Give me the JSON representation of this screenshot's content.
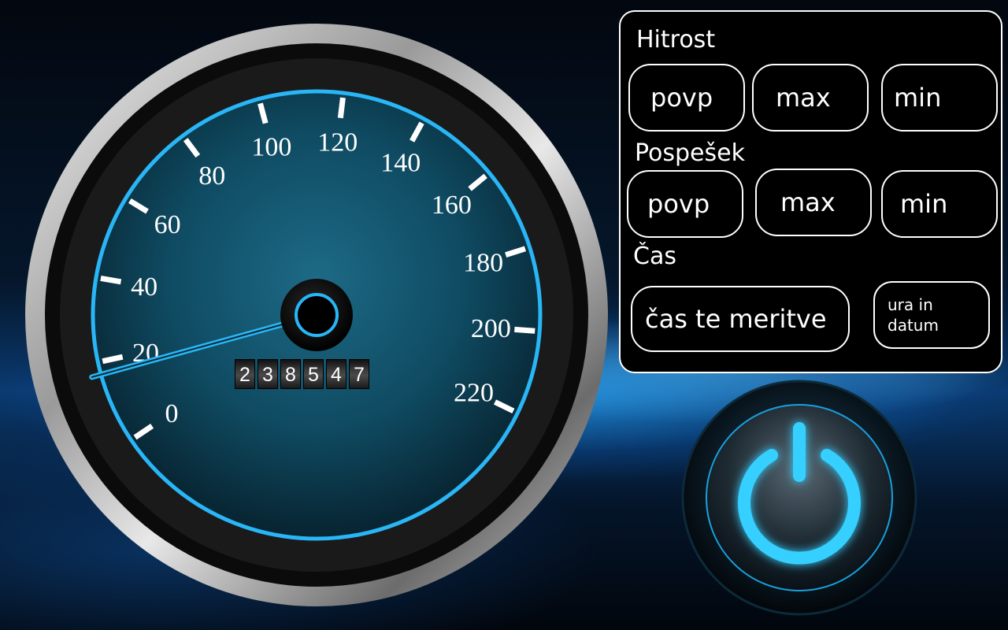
{
  "colors": {
    "accent": "#29b6f6",
    "accent_glow": "#35d0ff",
    "dial_face": "#0f4b62",
    "panel_bg": "#000000",
    "text": "#ffffff"
  },
  "speedometer": {
    "min_value": 0,
    "max_value": 220,
    "needle_value": 17,
    "tick_labels": [
      "0",
      "20",
      "40",
      "60",
      "80",
      "100",
      "120",
      "140",
      "160",
      "180",
      "200",
      "220"
    ],
    "odometer_digits": [
      "2",
      "3",
      "8",
      "5",
      "4",
      "7"
    ]
  },
  "panel": {
    "speed": {
      "label": "Hitrost",
      "avg_label": "povp",
      "max_label": "max",
      "min_label": "min"
    },
    "acceleration": {
      "label": "Pospešek",
      "avg_label": "povp",
      "max_label": "max",
      "min_label": "min"
    },
    "time": {
      "label": "Čas",
      "measurement_time_label": "čas te meritve",
      "clock_date_line1": "ura in",
      "clock_date_line2": "datum"
    }
  },
  "power_button": {
    "icon": "power-icon"
  }
}
